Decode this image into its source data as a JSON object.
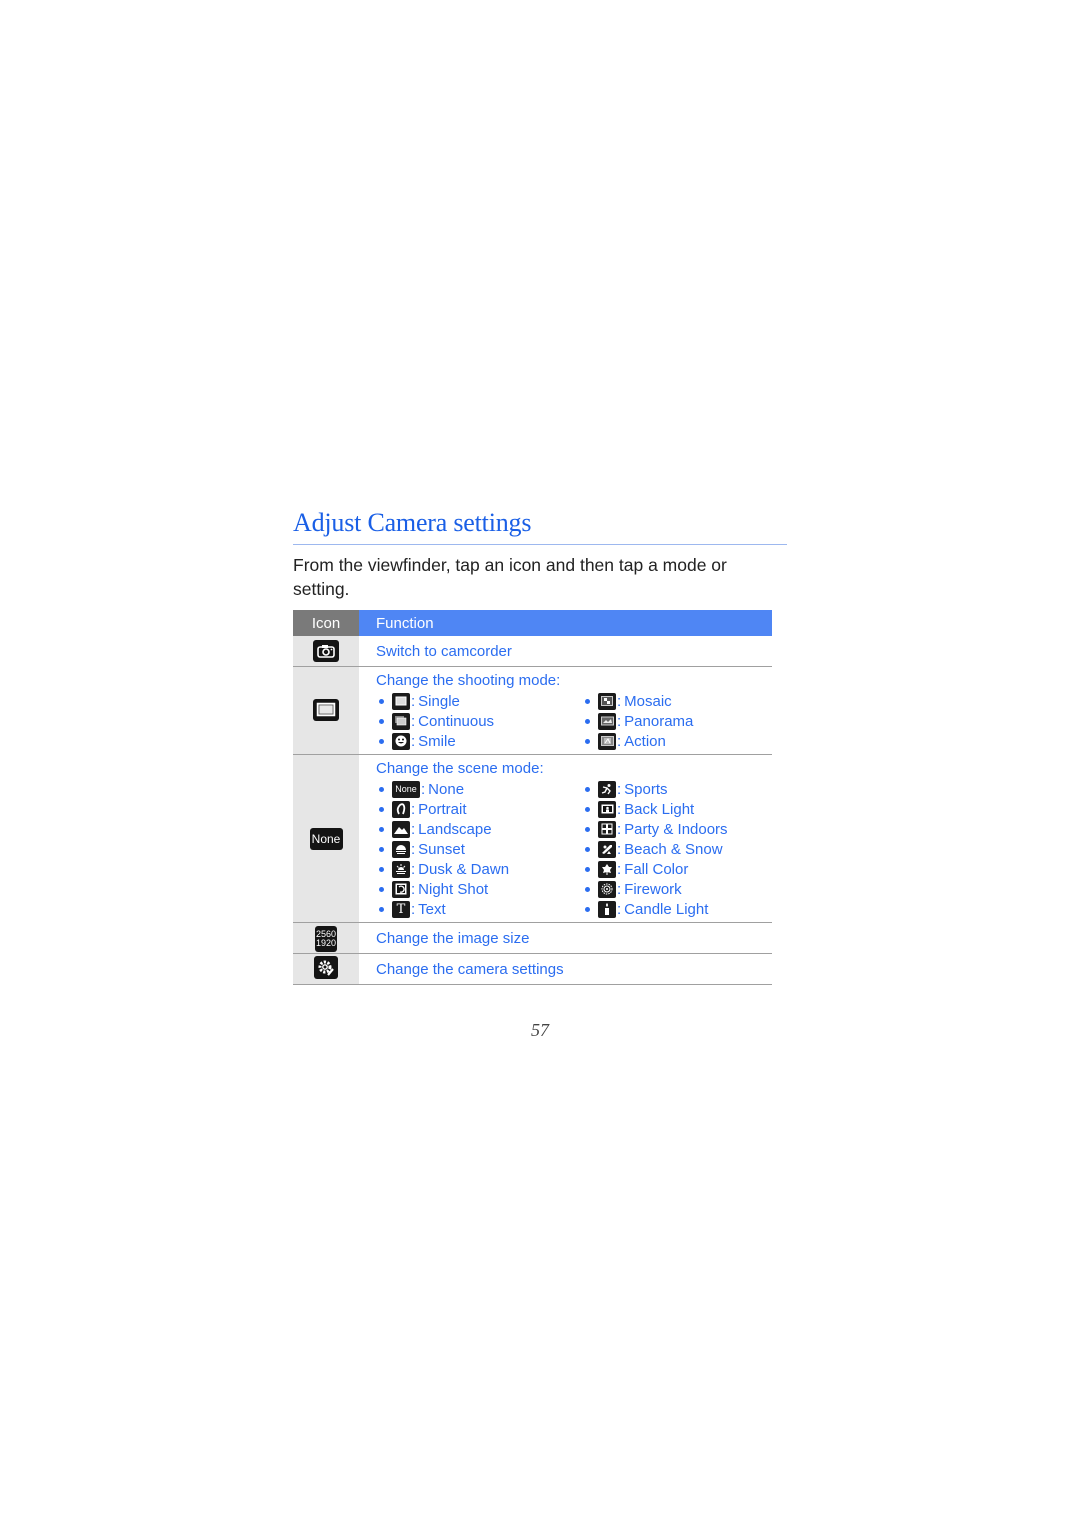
{
  "page": {
    "title": "Adjust Camera settings",
    "intro": "From the viewfinder, tap an icon and then tap a mode or setting.",
    "page_number": "57"
  },
  "table": {
    "headers": {
      "icon": "Icon",
      "function": "Function"
    },
    "rows": {
      "camcorder": {
        "icon": "camera-icon",
        "function": "Switch to camcorder"
      },
      "shooting": {
        "icon": "single-shot-icon",
        "heading": "Change the shooting mode:",
        "left": [
          {
            "icon": "single-icon",
            "label": "Single"
          },
          {
            "icon": "continuous-icon",
            "label": "Continuous"
          },
          {
            "icon": "smile-icon",
            "label": "Smile"
          }
        ],
        "right": [
          {
            "icon": "mosaic-icon",
            "label": "Mosaic"
          },
          {
            "icon": "panorama-icon",
            "label": "Panorama"
          },
          {
            "icon": "action-icon",
            "label": "Action"
          }
        ]
      },
      "scene": {
        "icon": "none-scene-icon",
        "icon_text": "None",
        "heading": "Change the scene mode:",
        "left": [
          {
            "icon": "none-icon",
            "label": "None",
            "glyph": "None"
          },
          {
            "icon": "portrait-icon",
            "label": "Portrait"
          },
          {
            "icon": "landscape-icon",
            "label": "Landscape"
          },
          {
            "icon": "sunset-icon",
            "label": "Sunset"
          },
          {
            "icon": "dusk-dawn-icon",
            "label": "Dusk & Dawn"
          },
          {
            "icon": "night-shot-icon",
            "label": "Night Shot"
          },
          {
            "icon": "text-icon",
            "label": "Text",
            "glyph": "T"
          }
        ],
        "right": [
          {
            "icon": "sports-icon",
            "label": "Sports"
          },
          {
            "icon": "back-light-icon",
            "label": "Back Light"
          },
          {
            "icon": "party-indoors-icon",
            "label": "Party & Indoors"
          },
          {
            "icon": "beach-snow-icon",
            "label": "Beach & Snow"
          },
          {
            "icon": "fall-color-icon",
            "label": "Fall Color"
          },
          {
            "icon": "firework-icon",
            "label": "Firework"
          },
          {
            "icon": "candle-light-icon",
            "label": "Candle Light"
          }
        ]
      },
      "image_size": {
        "icon": "image-size-icon",
        "icon_line1": "2560",
        "icon_line2": "1920",
        "function": "Change the image size"
      },
      "settings": {
        "icon": "settings-gear-icon",
        "function": "Change the camera settings"
      }
    }
  },
  "colors": {
    "accent": "#2b6df0",
    "header_blue": "#4f86f4",
    "header_gray": "#7a7a7a",
    "icon_cell": "#e6e6e6"
  }
}
